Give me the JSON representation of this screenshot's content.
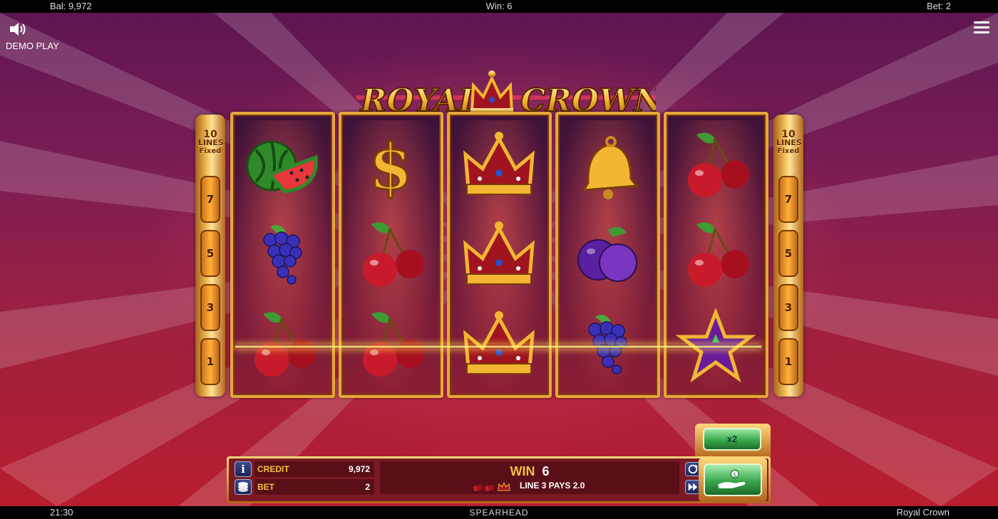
{
  "topbar": {
    "balance": "Bal: 9,972",
    "win": "Win: 6",
    "bet": "Bet: 2"
  },
  "bottombar": {
    "clock": "21:30",
    "brand": "SPEARHEAD",
    "game_name": "Royal Crown"
  },
  "overlay": {
    "demo_label": "DEMO PLAY",
    "sound_icon": "speaker-icon",
    "menu_icon": "hamburger-menu-icon"
  },
  "logo": {
    "text_left": "ROYAL",
    "text_right": "CROWN"
  },
  "sidebars": {
    "lines_count": "10",
    "lines_label": "LINES",
    "fixed_label": "Fixed",
    "line_numbers": [
      "7",
      "5",
      "3",
      "1"
    ]
  },
  "reels": [
    [
      "watermelon",
      "grapes",
      "cherries"
    ],
    [
      "dollar",
      "cherries",
      "cherries"
    ],
    [
      "crown",
      "crown",
      "crown"
    ],
    [
      "bell",
      "plum",
      "grapes"
    ],
    [
      "cherries",
      "cherries",
      "star"
    ]
  ],
  "panel": {
    "credit_label": "CREDIT",
    "credit_value": "9,972",
    "bet_label": "BET",
    "bet_value": "2",
    "win_label": "WIN",
    "win_value": "6",
    "win_line_text": "LINE 3 PAYS 2.0",
    "info_icon": "info-icon",
    "coins_icon": "coins-icon",
    "autoplay_icon": "autoplay-icon",
    "turbo_icon": "fast-forward-icon"
  },
  "buttons": {
    "x2_label": "x2",
    "spin_icon": "hand-coin-icon"
  },
  "colors": {
    "gold": "#e8a53c",
    "label_yellow": "#f0c040",
    "panel_red": "#7c1a24",
    "green": "#38a84a"
  }
}
